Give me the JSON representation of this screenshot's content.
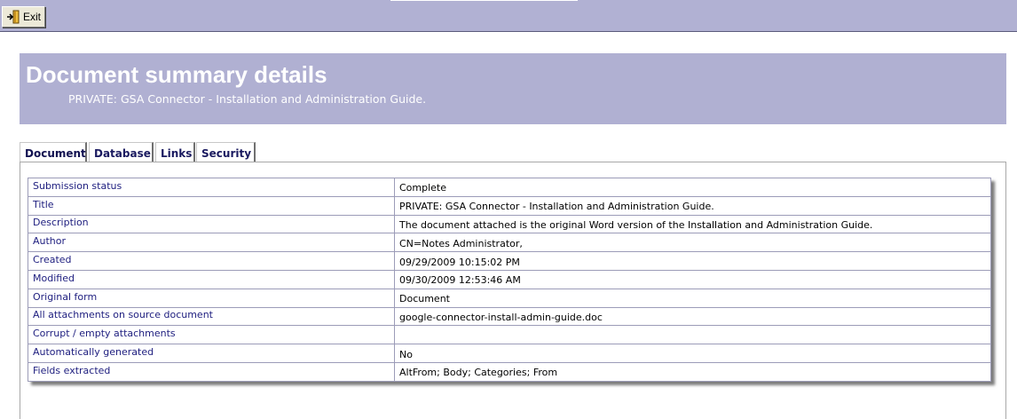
{
  "toolbar": {
    "exit_label": "Exit",
    "exit_icon": "exit-door-icon"
  },
  "header": {
    "title": "Document summary details",
    "subtitle": "PRIVATE: GSA Connector - Installation and Administration Guide."
  },
  "tabs": [
    {
      "label": "Document",
      "active": true
    },
    {
      "label": "Database",
      "active": false
    },
    {
      "label": "Links",
      "active": false
    },
    {
      "label": "Security",
      "active": false
    }
  ],
  "details": [
    {
      "label": "Submission status",
      "value": "Complete"
    },
    {
      "label": "Title",
      "value": "PRIVATE: GSA Connector - Installation and Administration Guide."
    },
    {
      "label": "Description",
      "value": "The document attached is the original Word version of the Installation and Administration Guide."
    },
    {
      "label": "Author",
      "value": "CN=Notes Administrator,"
    },
    {
      "label": "Created",
      "value": "09/29/2009 10:15:02 PM"
    },
    {
      "label": "Modified",
      "value": "09/30/2009 12:53:46 AM"
    },
    {
      "label": "Original form",
      "value": "Document"
    },
    {
      "label": "All attachments on source document",
      "value": "google-connector-install-admin-guide.doc"
    },
    {
      "label": "Corrupt / empty attachments",
      "value": ""
    },
    {
      "label": "Automatically generated",
      "value": "No"
    },
    {
      "label": "Fields extracted",
      "value": "AltFrom; Body; Categories; From"
    }
  ],
  "colors": {
    "toolbar_bg": "#b1b1d3",
    "header_bg": "#b0b0d2",
    "label_text": "#202080",
    "tab_text": "#1a1a60"
  }
}
